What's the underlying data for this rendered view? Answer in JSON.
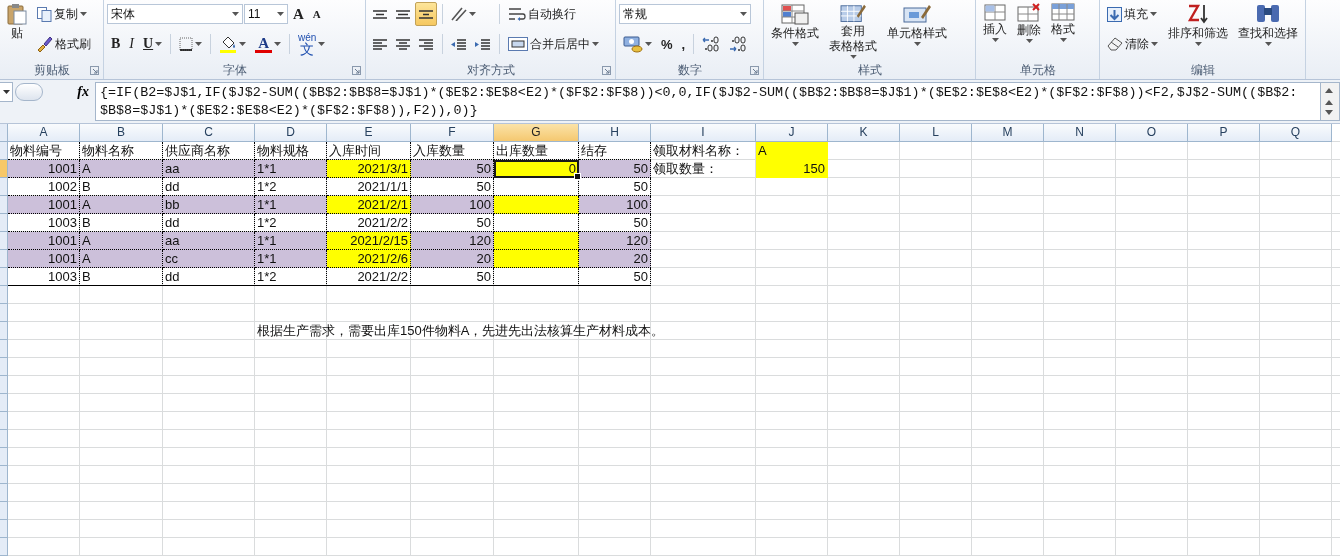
{
  "ribbon": [
    {
      "kind": "clipboard",
      "label": "剪贴板",
      "launcher": true,
      "items": [
        {
          "kind": "paste",
          "text_lines": [
            "贴"
          ],
          "menu": false
        },
        {
          "kind": "stack",
          "lines": [
            {
              "controls": [
                {
                  "kind": "copy",
                  "text": "复制",
                  "menu": true
                }
              ]
            },
            {
              "controls": [
                {
                  "kind": "brush",
                  "text": "格式刷",
                  "menu": false
                }
              ]
            }
          ]
        }
      ]
    },
    {
      "kind": "font",
      "label": "字体",
      "launcher": true,
      "items": [
        {
          "kind": "stack",
          "lines": [
            {
              "controls": [
                {
                  "kind": "font-name",
                  "text": "宋体"
                },
                {
                  "kind": "font-size",
                  "text": "11"
                },
                {
                  "kind": "grow",
                  "text": "A",
                  "menu": false
                },
                {
                  "kind": "shrink",
                  "text": "A",
                  "menu": false
                }
              ]
            },
            {
              "controls": [
                {
                  "kind": "bold",
                  "text": "B",
                  "menu": false
                },
                {
                  "kind": "italic",
                  "text": "I",
                  "menu": false
                },
                {
                  "kind": "underline",
                  "text": "U",
                  "menu": true
                },
                {
                  "kind": "sep"
                },
                {
                  "kind": "border",
                  "menu": true
                },
                {
                  "kind": "sep"
                },
                {
                  "kind": "fill",
                  "menu": true
                },
                {
                  "kind": "fontcolor",
                  "text": "A",
                  "menu": true
                },
                {
                  "kind": "sep"
                },
                {
                  "kind": "phonetic",
                  "caption": "wén",
                  "text": "文",
                  "menu": true
                }
              ]
            }
          ]
        }
      ]
    },
    {
      "kind": "alignment",
      "label": "对齐方式",
      "launcher": true,
      "items": [
        {
          "kind": "stack",
          "lines": [
            {
              "controls": [
                {
                  "kind": "align-top",
                  "menu": false,
                  "pressed": false
                },
                {
                  "kind": "align-middle",
                  "menu": false,
                  "pressed": false
                },
                {
                  "kind": "align-bottom",
                  "menu": false,
                  "pressed": true
                }
              ]
            },
            {
              "controls": [
                {
                  "kind": "align-left",
                  "menu": false,
                  "pressed": false
                },
                {
                  "kind": "align-center",
                  "menu": false,
                  "pressed": false
                },
                {
                  "kind": "align-right",
                  "menu": false,
                  "pressed": false
                }
              ]
            }
          ]
        },
        {
          "kind": "stack",
          "lines": [
            {
              "controls": [
                {
                  "kind": "sep"
                },
                {
                  "kind": "orientation",
                  "menu": true
                }
              ]
            },
            {
              "controls": [
                {
                  "kind": "sep"
                },
                {
                  "kind": "indent-less",
                  "menu": false
                },
                {
                  "kind": "indent-more",
                  "menu": false
                }
              ]
            }
          ]
        },
        {
          "kind": "stack",
          "lines": [
            {
              "controls": [
                {
                  "kind": "sep"
                },
                {
                  "kind": "wrap",
                  "text": "自动换行",
                  "menu": false
                }
              ]
            },
            {
              "controls": [
                {
                  "kind": "sep"
                },
                {
                  "kind": "merge",
                  "text": "合并后居中",
                  "menu": true
                }
              ]
            }
          ]
        }
      ]
    },
    {
      "kind": "number",
      "label": "数字",
      "launcher": true,
      "items": [
        {
          "kind": "stack",
          "lines": [
            {
              "controls": [
                {
                  "kind": "number-format",
                  "text": "常规"
                }
              ]
            },
            {
              "controls": [
                {
                  "kind": "currency",
                  "menu": true
                },
                {
                  "kind": "percent",
                  "text": "%",
                  "menu": false
                },
                {
                  "kind": "comma",
                  "text": ",",
                  "menu": false
                },
                {
                  "kind": "sep"
                },
                {
                  "kind": "dec-more",
                  "menu": false
                },
                {
                  "kind": "dec-less",
                  "menu": false
                }
              ]
            }
          ]
        }
      ]
    },
    {
      "kind": "styles",
      "label": "样式",
      "launcher": false,
      "items": [
        {
          "kind": "cond",
          "text_lines": [
            "条件格式"
          ],
          "menu": true
        },
        {
          "kind": "table-format",
          "text_lines": [
            "套用",
            "表格格式"
          ],
          "menu": true
        },
        {
          "kind": "cell-style",
          "text_lines": [
            "单元格样式"
          ],
          "menu": true
        }
      ]
    },
    {
      "kind": "cells",
      "label": "单元格",
      "launcher": false,
      "items": [
        {
          "kind": "insert",
          "text_lines": [
            "插入"
          ],
          "menu": true
        },
        {
          "kind": "delete",
          "text_lines": [
            "删除"
          ],
          "menu": true
        },
        {
          "kind": "format",
          "text_lines": [
            "格式"
          ],
          "menu": true
        }
      ]
    },
    {
      "kind": "editing",
      "label": "编辑",
      "launcher": false,
      "items": [
        {
          "kind": "stack",
          "lines": [
            {
              "controls": [
                {
                  "kind": "fill-down",
                  "text": "填充",
                  "menu": true
                }
              ]
            },
            {
              "controls": [
                {
                  "kind": "eraser",
                  "text": "清除",
                  "menu": true
                }
              ]
            }
          ]
        },
        {
          "kind": "sort",
          "text_lines": [
            "排序和筛选"
          ],
          "menu": true
        },
        {
          "kind": "find",
          "text_lines": [
            "查找和选择"
          ],
          "menu": true
        }
      ]
    }
  ],
  "formula_bar": {
    "fx_label": "fx",
    "formula_lines": [
      "{=IF(B2=$J$1,IF($J$2-SUM(($B$2:$B$8=$J$1)*($E$2:$E$8<E2)*($F$2:$F$8))<0,0,IF($J$2-SUM(($B$2:$B$8=$J$1)*($E$2:$E$8<E2)*($F$2:$F$8))<F2,$J$2-SUM(($B$2:",
      "$B$8=$J$1)*($E$2:$E$8<E2)*($F$2:$F$8)),F2)),0)}"
    ]
  },
  "sheet": {
    "columns": [
      {
        "label": "A",
        "selected": false
      },
      {
        "label": "B",
        "selected": false
      },
      {
        "label": "C",
        "selected": false
      },
      {
        "label": "D",
        "selected": false
      },
      {
        "label": "E",
        "selected": false
      },
      {
        "label": "F",
        "selected": false
      },
      {
        "label": "G",
        "selected": true
      },
      {
        "label": "H",
        "selected": false
      },
      {
        "label": "I",
        "selected": false
      },
      {
        "label": "J",
        "selected": false
      },
      {
        "label": "K",
        "selected": false
      },
      {
        "label": "L",
        "selected": false
      },
      {
        "label": "M",
        "selected": false
      },
      {
        "label": "N",
        "selected": false
      },
      {
        "label": "O",
        "selected": false
      },
      {
        "label": "P",
        "selected": false
      },
      {
        "label": "Q",
        "selected": false
      }
    ],
    "table": {
      "rows": [
        {
          "cells": [
            {
              "text": "物料编号",
              "kind": "text",
              "selected": false
            },
            {
              "text": "物料名称",
              "kind": "text",
              "selected": false
            },
            {
              "text": "供应商名称",
              "kind": "text",
              "selected": false
            },
            {
              "text": "物料规格",
              "kind": "text",
              "selected": false
            },
            {
              "text": "入库时间",
              "kind": "text",
              "selected": false
            },
            {
              "text": "入库数量",
              "kind": "text",
              "selected": false
            },
            {
              "text": "出库数量",
              "kind": "text",
              "selected": false
            },
            {
              "text": "结存",
              "kind": "text",
              "selected": false
            }
          ]
        },
        {
          "cells": [
            {
              "text": "1001",
              "kind": "number",
              "color": "#ccc0da",
              "selected": false
            },
            {
              "text": "A",
              "kind": "text",
              "color": "#ccc0da",
              "selected": false
            },
            {
              "text": "aa",
              "kind": "text",
              "color": "#ccc0da",
              "selected": false
            },
            {
              "text": "1*1",
              "kind": "text",
              "color": "#ccc0da",
              "selected": false
            },
            {
              "text": "2021/3/1",
              "kind": "number",
              "color": "#ffff00",
              "selected": false
            },
            {
              "text": "50",
              "kind": "number",
              "color": "#ccc0da",
              "selected": false
            },
            {
              "text": "0",
              "kind": "number",
              "color": "#ffff00",
              "selected": true
            },
            {
              "text": "50",
              "kind": "number",
              "color": "#ccc0da",
              "selected": false
            }
          ]
        },
        {
          "cells": [
            {
              "text": "1002",
              "kind": "number",
              "selected": false
            },
            {
              "text": "B",
              "kind": "text",
              "selected": false
            },
            {
              "text": "dd",
              "kind": "text",
              "selected": false
            },
            {
              "text": "1*2",
              "kind": "text",
              "selected": false
            },
            {
              "text": "2021/1/1",
              "kind": "number",
              "selected": false
            },
            {
              "text": "50",
              "kind": "number",
              "selected": false
            },
            {
              "kind": "number",
              "selected": false
            },
            {
              "text": "50",
              "kind": "number",
              "selected": false
            }
          ]
        },
        {
          "cells": [
            {
              "text": "1001",
              "kind": "number",
              "color": "#ccc0da",
              "selected": false
            },
            {
              "text": "A",
              "kind": "text",
              "color": "#ccc0da",
              "selected": false
            },
            {
              "text": "bb",
              "kind": "text",
              "color": "#ccc0da",
              "selected": false
            },
            {
              "text": "1*1",
              "kind": "text",
              "color": "#ccc0da",
              "selected": false
            },
            {
              "text": "2021/2/1",
              "kind": "number",
              "color": "#ffff00",
              "selected": false
            },
            {
              "text": "100",
              "kind": "number",
              "color": "#ccc0da",
              "selected": false
            },
            {
              "kind": "number",
              "color": "#ffff00",
              "selected": false
            },
            {
              "text": "100",
              "kind": "number",
              "color": "#ccc0da",
              "selected": false
            }
          ]
        },
        {
          "cells": [
            {
              "text": "1003",
              "kind": "number",
              "selected": false
            },
            {
              "text": "B",
              "kind": "text",
              "selected": false
            },
            {
              "text": "dd",
              "kind": "text",
              "selected": false
            },
            {
              "text": "1*2",
              "kind": "text",
              "selected": false
            },
            {
              "text": "2021/2/2",
              "kind": "number",
              "selected": false
            },
            {
              "text": "50",
              "kind": "number",
              "selected": false
            },
            {
              "kind": "number",
              "selected": false
            },
            {
              "text": "50",
              "kind": "number",
              "selected": false
            }
          ]
        },
        {
          "cells": [
            {
              "text": "1001",
              "kind": "number",
              "color": "#ccc0da",
              "selected": false
            },
            {
              "text": "A",
              "kind": "text",
              "color": "#ccc0da",
              "selected": false
            },
            {
              "text": "aa",
              "kind": "text",
              "color": "#ccc0da",
              "selected": false
            },
            {
              "text": "1*1",
              "kind": "text",
              "color": "#ccc0da",
              "selected": false
            },
            {
              "text": "2021/2/15",
              "kind": "number",
              "color": "#ffff00",
              "selected": false
            },
            {
              "text": "120",
              "kind": "number",
              "color": "#ccc0da",
              "selected": false
            },
            {
              "kind": "number",
              "color": "#ffff00",
              "selected": false
            },
            {
              "text": "120",
              "kind": "number",
              "color": "#ccc0da",
              "selected": false
            }
          ]
        },
        {
          "cells": [
            {
              "text": "1001",
              "kind": "number",
              "color": "#ccc0da",
              "selected": false
            },
            {
              "text": "A",
              "kind": "text",
              "color": "#ccc0da",
              "selected": false
            },
            {
              "text": "cc",
              "kind": "text",
              "color": "#ccc0da",
              "selected": false
            },
            {
              "text": "1*1",
              "kind": "text",
              "color": "#ccc0da",
              "selected": false
            },
            {
              "text": "2021/2/6",
              "kind": "number",
              "color": "#ffff00",
              "selected": false
            },
            {
              "text": "20",
              "kind": "number",
              "color": "#ccc0da",
              "selected": false
            },
            {
              "kind": "number",
              "color": "#ffff00",
              "selected": false
            },
            {
              "text": "20",
              "kind": "number",
              "color": "#ccc0da",
              "selected": false
            }
          ]
        },
        {
          "cells": [
            {
              "text": "1003",
              "kind": "number",
              "selected": false
            },
            {
              "text": "B",
              "kind": "text",
              "selected": false
            },
            {
              "text": "dd",
              "kind": "text",
              "selected": false
            },
            {
              "text": "1*2",
              "kind": "text",
              "selected": false
            },
            {
              "text": "2021/2/2",
              "kind": "number",
              "selected": false
            },
            {
              "text": "50",
              "kind": "number",
              "selected": false
            },
            {
              "kind": "number",
              "selected": false
            },
            {
              "text": "50",
              "kind": "number",
              "selected": false
            }
          ]
        }
      ]
    },
    "lookup": [
      {
        "label": "领取材料名称：",
        "value": "A",
        "kind": "text",
        "color": "#ffff00"
      },
      {
        "label": "领取数量：",
        "value": "150",
        "kind": "number",
        "color": "#ffff00"
      }
    ],
    "note": "根据生产需求，需要出库150件物料A，先进先出法核算生产材料成本。"
  }
}
